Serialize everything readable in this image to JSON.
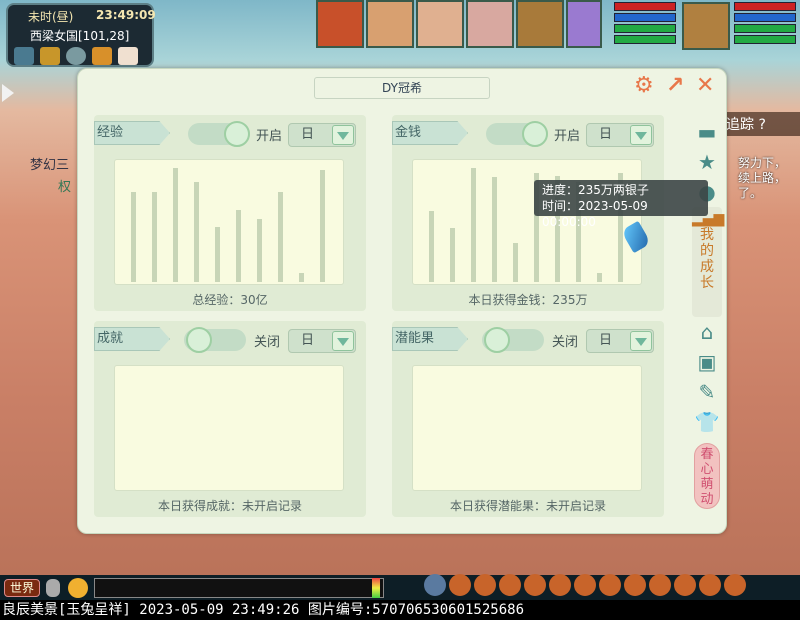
{
  "hud": {
    "time_period": "未时(昼)",
    "clock": "23:49:09",
    "location": "西梁女国[101,28]"
  },
  "scene": {
    "track_label": "追踪",
    "track_help": "?",
    "side_lines": [
      "努力下，",
      "续上路，",
      "了。"
    ],
    "left_name": "梦幻三",
    "left_sub": "权"
  },
  "panel": {
    "title": "DY冠希",
    "icons": [
      "gear-icon",
      "external-link-icon",
      "close-icon"
    ],
    "cards": [
      {
        "label": "经验",
        "toggle_on": true,
        "toggle_label": "开启",
        "period": "日",
        "footer": "总经验：30亿",
        "bars": [
          0.79,
          0.79,
          1.0,
          0.88,
          0.48,
          0.63,
          0.55,
          0.79,
          0.08,
          0.98
        ]
      },
      {
        "label": "金钱",
        "toggle_on": true,
        "toggle_label": "开启",
        "period": "日",
        "footer": "本日获得金钱：235万",
        "bars": [
          0.62,
          0.47,
          1.0,
          0.92,
          0.34,
          0.96,
          0.93,
          0.88,
          0.08,
          0.96
        ]
      },
      {
        "label": "成就",
        "toggle_on": false,
        "toggle_label": "关闭",
        "period": "日",
        "footer": "本日获得成就：未开启记录"
      },
      {
        "label": "潜能果",
        "toggle_on": false,
        "toggle_label": "关闭",
        "period": "日",
        "footer": "本日获得潜能果：未开启记录"
      }
    ],
    "tooltip": {
      "line1": "进度：235万两银子",
      "line2": "时间：2023-05-09 00:00:00"
    },
    "tabs": {
      "active": "我的成长",
      "spring": "春心萌动"
    }
  },
  "chat": {
    "channel": "世界"
  },
  "status": {
    "text": "良辰美景[玉兔呈祥] 2023-05-09 23:49:26 图片编号:570706530601525686"
  },
  "colors": {
    "accent": "#e8774a",
    "tab_icon": "#4a8c88",
    "panel_bg": "#eef4e3"
  }
}
